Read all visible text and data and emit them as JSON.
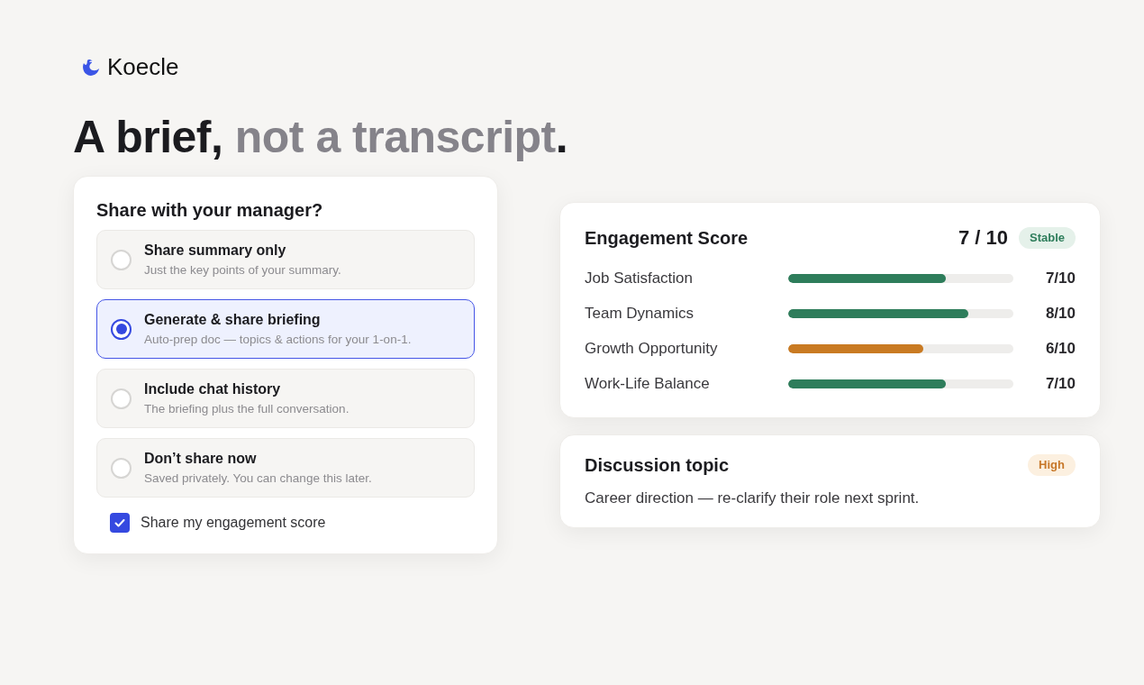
{
  "brand": {
    "name": "Koecle"
  },
  "headline": {
    "text": "A brief,",
    "muted_text": "not a transcript",
    "end": "."
  },
  "share_card": {
    "title": "Share with your manager?",
    "options": [
      {
        "title": "Share summary only",
        "description": "Just the key points of your summary.",
        "selected": false
      },
      {
        "title": "Generate & share briefing",
        "description": "Auto-prep doc — topics & actions for your 1-on-1.",
        "selected": true
      },
      {
        "title": "Include chat history",
        "description": "The briefing plus the full conversation.",
        "selected": false
      },
      {
        "title": "Don’t share now",
        "description": "Saved privately. You can change this later.",
        "selected": false
      }
    ],
    "checkbox": {
      "label": "Share my engagement score",
      "checked": true
    }
  },
  "engagement": {
    "title": "Engagement Score",
    "score": "7 / 10",
    "badge": {
      "label": "Stable",
      "kind": "good"
    },
    "metrics": [
      {
        "label": "Job Satisfaction",
        "level": 0.7,
        "value": "7/10",
        "color": "#2e7d5b"
      },
      {
        "label": "Team Dynamics",
        "level": 0.8,
        "value": "8/10",
        "color": "#2e7d5b"
      },
      {
        "label": "Growth Opportunity",
        "level": 0.6,
        "value": "6/10",
        "color": "#c97a22"
      },
      {
        "label": "Work-Life Balance",
        "level": 0.7,
        "value": "7/10",
        "color": "#2e7d5b"
      }
    ]
  },
  "discussion": {
    "title": "Discussion topic",
    "badge": {
      "label": "High",
      "kind": "warning"
    },
    "text": "Career direction — re-clarify their role next sprint."
  }
}
